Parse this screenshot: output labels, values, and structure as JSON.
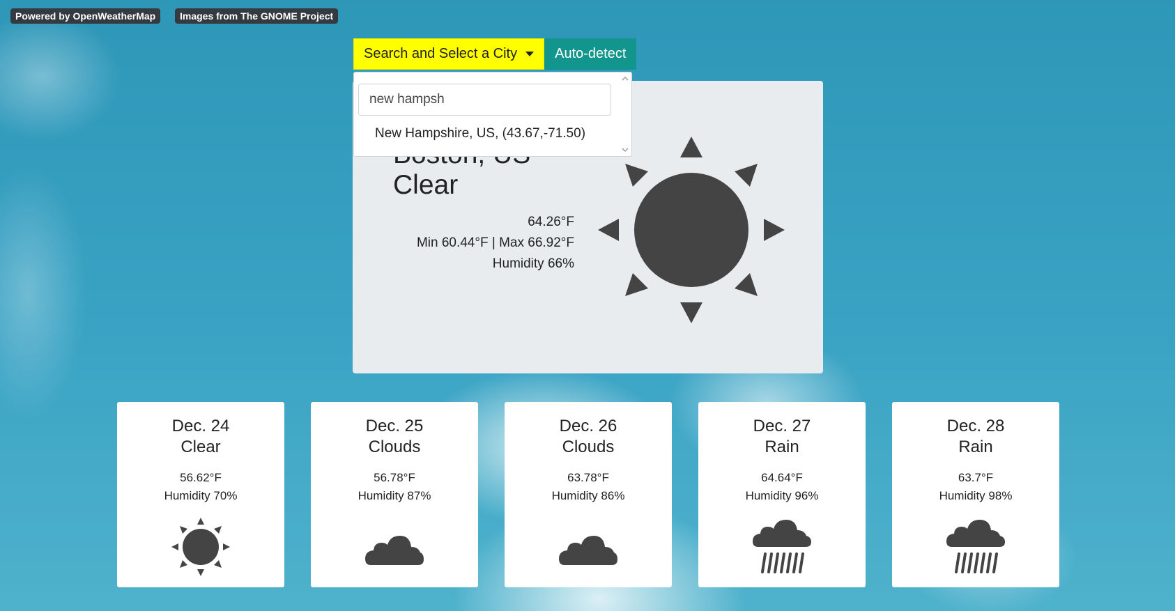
{
  "badges": {
    "owm": "Powered by OpenWeatherMap",
    "gnome": "Images from The GNOME Project"
  },
  "controls": {
    "search_label": "Search and Select a City",
    "autodetect_label": "Auto-detect"
  },
  "dropdown": {
    "input_value": "new hampsh",
    "result": "New Hampshire, US, (43.67,-71.50)"
  },
  "current": {
    "city": "Boston, US",
    "condition": "Clear",
    "temp": "64.26°F",
    "minmax": "Min 60.44°F | Max 66.92°F",
    "humidity": "Humidity 66%",
    "icon": "sun-icon"
  },
  "forecast": [
    {
      "date": "Dec. 24",
      "condition": "Clear",
      "temp": "56.62°F",
      "humidity": "Humidity 70%",
      "icon": "sun-icon"
    },
    {
      "date": "Dec. 25",
      "condition": "Clouds",
      "temp": "56.78°F",
      "humidity": "Humidity 87%",
      "icon": "cloud-icon"
    },
    {
      "date": "Dec. 26",
      "condition": "Clouds",
      "temp": "63.78°F",
      "humidity": "Humidity 86%",
      "icon": "cloud-icon"
    },
    {
      "date": "Dec. 27",
      "condition": "Rain",
      "temp": "64.64°F",
      "humidity": "Humidity 96%",
      "icon": "rain-icon"
    },
    {
      "date": "Dec. 28",
      "condition": "Rain",
      "temp": "63.7°F",
      "humidity": "Humidity 98%",
      "icon": "rain-icon"
    }
  ],
  "colors": {
    "search_button": "#ffff00",
    "autodetect_button": "#12958c",
    "icon": "#444444",
    "card": "#e9ecef"
  }
}
